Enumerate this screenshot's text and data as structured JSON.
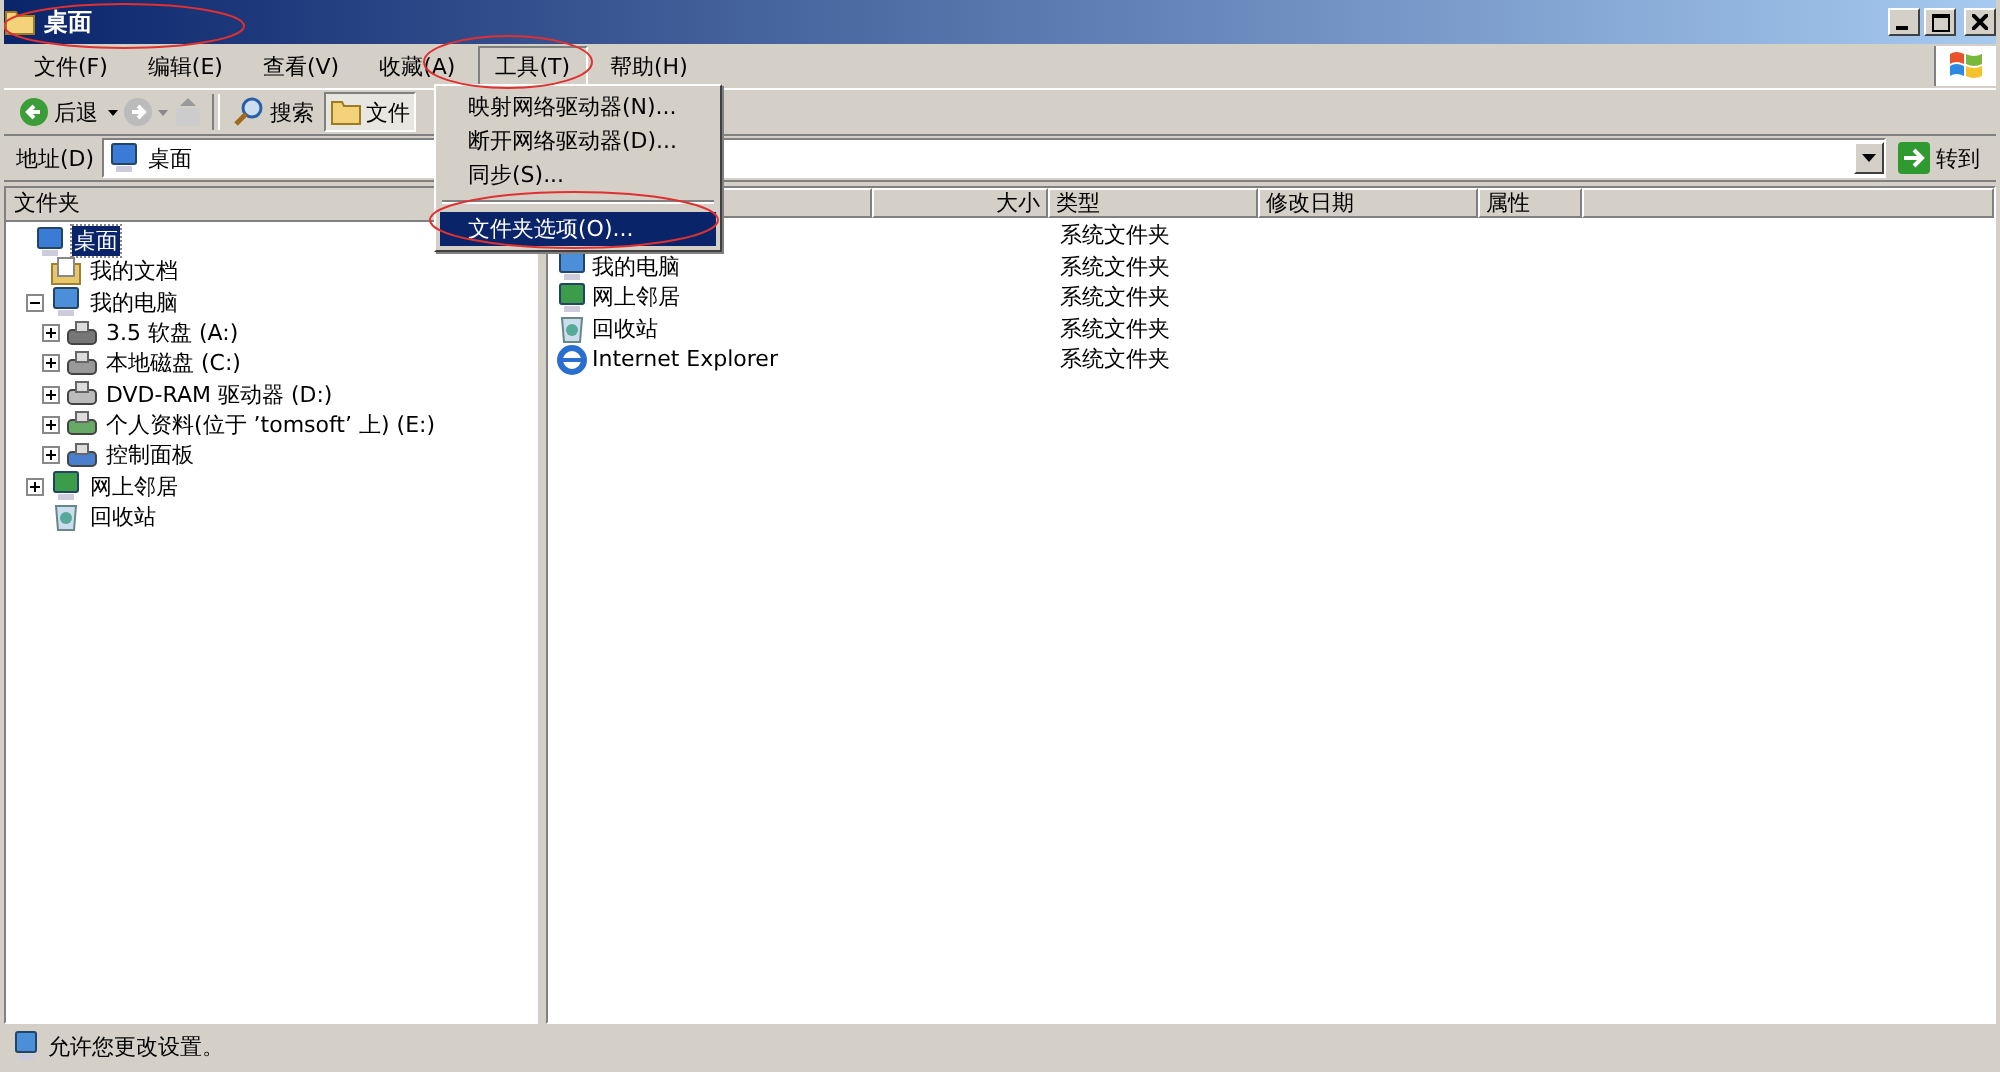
{
  "window": {
    "title": "桌面"
  },
  "menu_bar": [
    {
      "label": "文件(F)",
      "selected": false
    },
    {
      "label": "编辑(E)",
      "selected": false
    },
    {
      "label": "查看(V)",
      "selected": false
    },
    {
      "label": "收藏(A)",
      "selected": false
    },
    {
      "label": "工具(T)",
      "selected": true
    },
    {
      "label": "帮助(H)",
      "selected": false
    }
  ],
  "toolbar": {
    "back": "后退",
    "search": "搜索",
    "folders": "文件"
  },
  "address_bar": {
    "label": "地址(D)",
    "value": "桌面",
    "go": "转到"
  },
  "tools_menu": [
    {
      "label": "映射网络驱动器(N)...",
      "kind": "item",
      "selected": false
    },
    {
      "label": "断开网络驱动器(D)...",
      "kind": "item",
      "selected": false
    },
    {
      "label": "同步(S)...",
      "kind": "item",
      "selected": false
    },
    {
      "kind": "separator"
    },
    {
      "label": "文件夹选项(O)...",
      "kind": "item",
      "selected": true
    }
  ],
  "folders_pane": {
    "title": "文件夹",
    "tree": [
      {
        "label": "桌面",
        "kind": "desktop",
        "selected": true,
        "children": [
          {
            "label": "我的文档",
            "kind": "documents",
            "selected": false
          },
          {
            "label": "我的电脑",
            "kind": "computer",
            "selected": false,
            "expanded": true,
            "children": [
              {
                "label": "3.5 软盘 (A:)",
                "kind": "floppy",
                "selected": false,
                "expanded": false
              },
              {
                "label": "本地磁盘 (C:)",
                "kind": "disk",
                "selected": false,
                "expanded": false
              },
              {
                "label": "DVD-RAM 驱动器 (D:)",
                "kind": "dvd",
                "selected": false,
                "expanded": false
              },
              {
                "label": "个人资料(位于 ’tomsoft’ 上) (E:)",
                "kind": "network-drive",
                "selected": false,
                "expanded": false
              },
              {
                "label": "控制面板",
                "kind": "control-panel",
                "selected": false,
                "expanded": false
              }
            ]
          },
          {
            "label": "网上邻居",
            "kind": "network",
            "selected": false,
            "expanded": false
          },
          {
            "label": "回收站",
            "kind": "recycle",
            "selected": false
          }
        ]
      }
    ]
  },
  "file_list": {
    "columns": [
      "大小",
      "类型",
      "修改日期",
      "属性"
    ],
    "rows": [
      {
        "type": "系统文件夹"
      },
      {
        "name": "我的电脑",
        "kind": "computer",
        "type": "系统文件夹"
      },
      {
        "name": "网上邻居",
        "kind": "network",
        "type": "系统文件夹"
      },
      {
        "name": "回收站",
        "kind": "recycle",
        "type": "系统文件夹"
      },
      {
        "name": "Internet Explorer",
        "kind": "ie",
        "type": "系统文件夹"
      }
    ]
  },
  "status_bar": {
    "text": "允许您更改设置。"
  }
}
